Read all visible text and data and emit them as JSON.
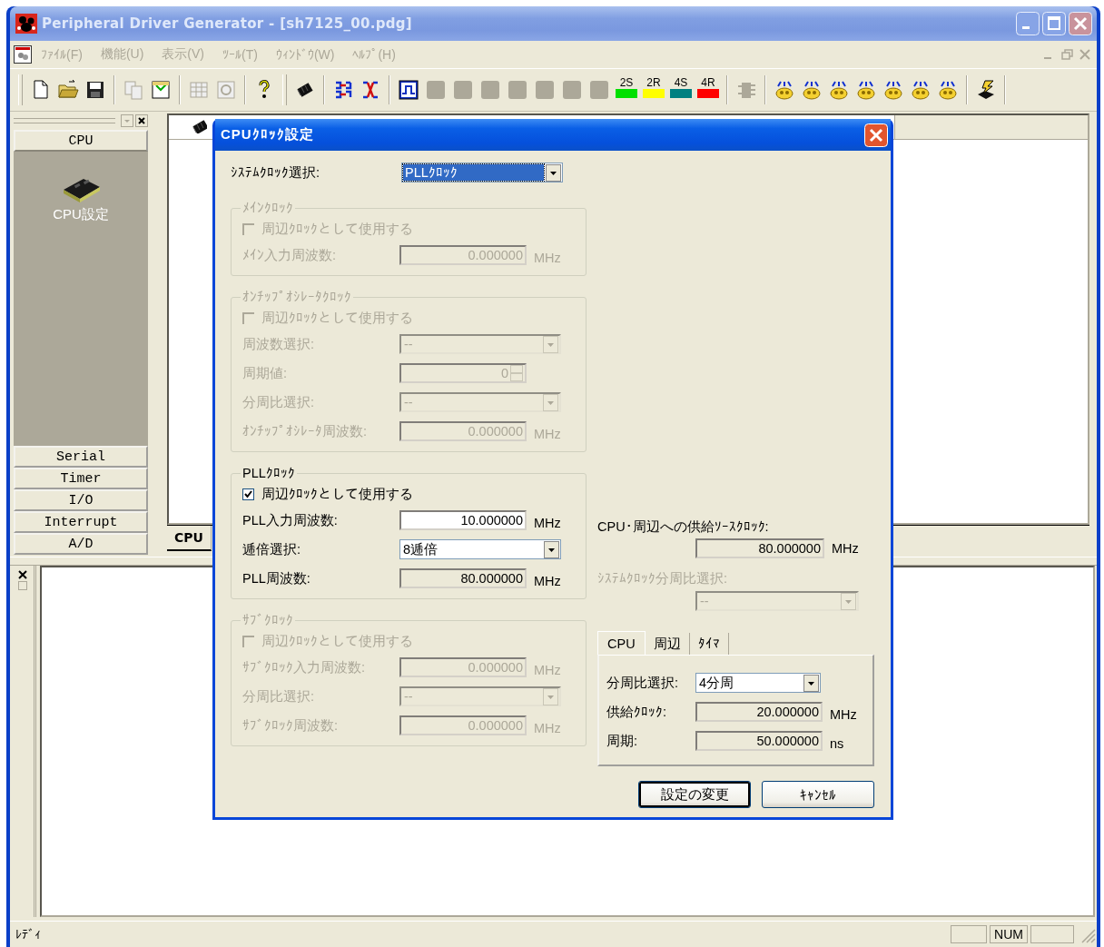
{
  "window": {
    "title": "Peripheral Driver Generator - [sh7125_00.pdg]"
  },
  "menu": [
    {
      "label": "ﾌｧｲﾙ(F)",
      "disabled": true
    },
    {
      "label": "機能(U)",
      "disabled": true
    },
    {
      "label": "表示(V)",
      "disabled": true
    },
    {
      "label": "ﾂｰﾙ(T)",
      "disabled": true
    },
    {
      "label": "ｳｨﾝﾄﾞｳ(W)",
      "disabled": true
    },
    {
      "label": "ﾍﾙﾌﾟ(H)",
      "disabled": true
    }
  ],
  "toolbar": {
    "channel_buttons": [
      {
        "label": "2S",
        "color": "#00e000"
      },
      {
        "label": "2R",
        "color": "#ffff00"
      },
      {
        "label": "4S",
        "color": "#008080"
      },
      {
        "label": "4R",
        "color": "#ff0000"
      }
    ]
  },
  "sidebar": {
    "items": [
      {
        "label": "CPU",
        "expanded": true,
        "children": [
          {
            "label": "CPU設定"
          }
        ]
      },
      {
        "label": "Serial",
        "expanded": false
      },
      {
        "label": "Timer",
        "expanded": false
      },
      {
        "label": "I/O",
        "expanded": false
      },
      {
        "label": "Interrupt",
        "expanded": false
      },
      {
        "label": "A/D",
        "expanded": false
      }
    ]
  },
  "document": {
    "tabs": [
      {
        "label": "CPU",
        "selected": true
      }
    ]
  },
  "dialog": {
    "title": "CPUｸﾛｯｸ設定",
    "system_clock": {
      "label": "ｼｽﾃﾑｸﾛｯｸ選択:",
      "value": "PLLｸﾛｯｸ",
      "focused": true
    },
    "groups": [
      {
        "title": "ﾒｲﾝｸﾛｯｸ",
        "disabled": true,
        "checkbox": {
          "label": "周辺ｸﾛｯｸとして使用する",
          "checked": false
        },
        "fields": [
          {
            "kind": "number",
            "label": "ﾒｲﾝ入力周波数:",
            "value": "0.000000",
            "unit": "MHz",
            "readonly": true
          }
        ]
      },
      {
        "title": "ｵﾝﾁｯﾌﾟｵｼﾚｰﾀｸﾛｯｸ",
        "disabled": true,
        "checkbox": {
          "label": "周辺ｸﾛｯｸとして使用する",
          "checked": false
        },
        "fields": [
          {
            "kind": "select",
            "label": "周波数選択:",
            "value": "--"
          },
          {
            "kind": "spin",
            "label": "周期値:",
            "value": "0"
          },
          {
            "kind": "select",
            "label": "分周比選択:",
            "value": "--"
          },
          {
            "kind": "number",
            "label": "ｵﾝﾁｯﾌﾟｵｼﾚｰﾀ周波数:",
            "value": "0.000000",
            "unit": "MHz",
            "readonly": true
          }
        ]
      },
      {
        "title": "PLLｸﾛｯｸ",
        "disabled": false,
        "checkbox": {
          "label": "周辺ｸﾛｯｸとして使用する",
          "checked": true
        },
        "fields": [
          {
            "kind": "number",
            "label": "PLL入力周波数:",
            "value": "10.000000",
            "unit": "MHz",
            "readonly": false
          },
          {
            "kind": "select",
            "label": "逓倍選択:",
            "value": "8逓倍"
          },
          {
            "kind": "number",
            "label": "PLL周波数:",
            "value": "80.000000",
            "unit": "MHz",
            "readonly": true
          }
        ]
      },
      {
        "title": "ｻﾌﾞｸﾛｯｸ",
        "disabled": true,
        "checkbox": {
          "label": "周辺ｸﾛｯｸとして使用する",
          "checked": false
        },
        "fields": [
          {
            "kind": "number",
            "label": "ｻﾌﾞｸﾛｯｸ入力周波数:",
            "value": "0.000000",
            "unit": "MHz",
            "readonly": true
          },
          {
            "kind": "select",
            "label": "分周比選択:",
            "value": "--"
          },
          {
            "kind": "number",
            "label": "ｻﾌﾞｸﾛｯｸ周波数:",
            "value": "0.000000",
            "unit": "MHz",
            "readonly": true
          }
        ]
      }
    ],
    "source_clock": {
      "label": "CPU･周辺への供給ｿｰｽｸﾛｯｸ:",
      "value": "80.000000",
      "unit": "MHz"
    },
    "system_divider": {
      "label": "ｼｽﾃﾑｸﾛｯｸ分周比選択:",
      "value": "--",
      "disabled": true
    },
    "tabs": [
      {
        "label": "CPU",
        "selected": true
      },
      {
        "label": "周辺",
        "selected": false
      },
      {
        "label": "ﾀｲﾏ",
        "selected": false
      }
    ],
    "tab_fields": [
      {
        "kind": "select",
        "label": "分周比選択:",
        "value": "4分周"
      },
      {
        "kind": "number",
        "label": "供給ｸﾛｯｸ:",
        "value": "20.000000",
        "unit": "MHz",
        "readonly": true
      },
      {
        "kind": "number",
        "label": "周期:",
        "value": "50.000000",
        "unit": "ns",
        "readonly": true
      }
    ],
    "buttons": [
      {
        "label": "設定の変更",
        "default": true
      },
      {
        "label": "ｷｬﾝｾﾙ",
        "default": false
      }
    ]
  },
  "status_bar": {
    "text": "ﾚﾃﾞｨ",
    "indicators": [
      {
        "label": "NUM"
      }
    ]
  }
}
